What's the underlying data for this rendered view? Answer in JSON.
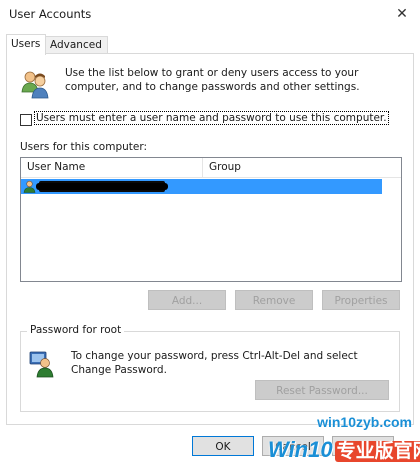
{
  "window": {
    "title": "User Accounts",
    "close_glyph": "✕"
  },
  "tabs": [
    {
      "label": "Users",
      "active": true
    },
    {
      "label": "Advanced",
      "active": false
    }
  ],
  "users_tab": {
    "intro_icon": "users-group-icon",
    "intro_text": "Use the list below to grant or deny users access to your computer, and to change passwords and other settings.",
    "require_login_checkbox": {
      "label": "Users must enter a user name and password to use this computer.",
      "checked": false
    },
    "users_list_label": "Users for this computer:",
    "columns": [
      "User Name",
      "Group"
    ],
    "rows": [
      {
        "icon": "user-icon",
        "selected": true,
        "redacted": true
      }
    ],
    "buttons": {
      "add": "Add...",
      "remove": "Remove",
      "properties": "Properties"
    },
    "password_group": {
      "legend": "Password for root",
      "icon": "user-key-icon",
      "text": "To change your password, press Ctrl-Alt-Del and select Change Password.",
      "reset_button": "Reset Password..."
    }
  },
  "footer": {
    "ok": "OK",
    "cancel": "Cancel",
    "apply": "Apply"
  },
  "watermark": {
    "url": "win10zyb.com",
    "logo_latin": "Win10",
    "logo_cn": "专业版官网"
  },
  "colors": {
    "selection": "#3399ff",
    "disabled_text": "#a0a0a0",
    "watermark_blue": "#1a8fd6",
    "watermark_red": "#e8462c"
  }
}
